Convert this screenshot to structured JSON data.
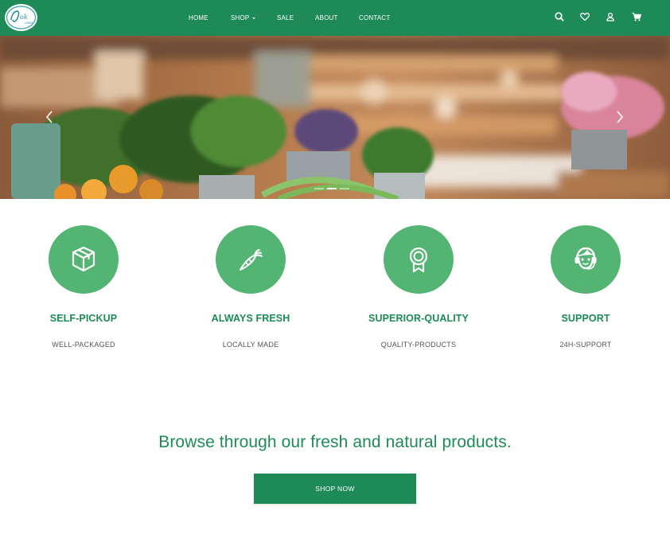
{
  "brand": {
    "logo_text": "Lok",
    "logo_subtext": "GRAM",
    "primary_color": "#1e8a57",
    "accent_color": "#53b473"
  },
  "nav": {
    "items": [
      {
        "label": "HOME"
      },
      {
        "label": "SHOP",
        "has_dropdown": true
      },
      {
        "label": "SALE"
      },
      {
        "label": "ABOUT"
      },
      {
        "label": "CONTACT"
      }
    ],
    "icons": [
      "search-icon",
      "heart-icon",
      "user-icon",
      "cart-icon"
    ]
  },
  "hero": {
    "slide_count": 3,
    "active_slide": 1,
    "arrows": [
      "chevron-left-icon",
      "chevron-right-icon"
    ]
  },
  "features": [
    {
      "icon": "box-icon",
      "title": "SELF-PICKUP",
      "subtitle": "WELL-PACKAGED"
    },
    {
      "icon": "carrot-icon",
      "title": "ALWAYS FRESH",
      "subtitle": "LOCALLY MADE"
    },
    {
      "icon": "award-icon",
      "title": "SUPERIOR-QUALITY",
      "subtitle": "QUALITY-PRODUCTS"
    },
    {
      "icon": "support-icon",
      "title": "SUPPORT",
      "subtitle": "24H-SUPPORT"
    }
  ],
  "browse": {
    "heading": "Browse through our fresh and natural products.",
    "button_label": "SHOP NOW"
  }
}
